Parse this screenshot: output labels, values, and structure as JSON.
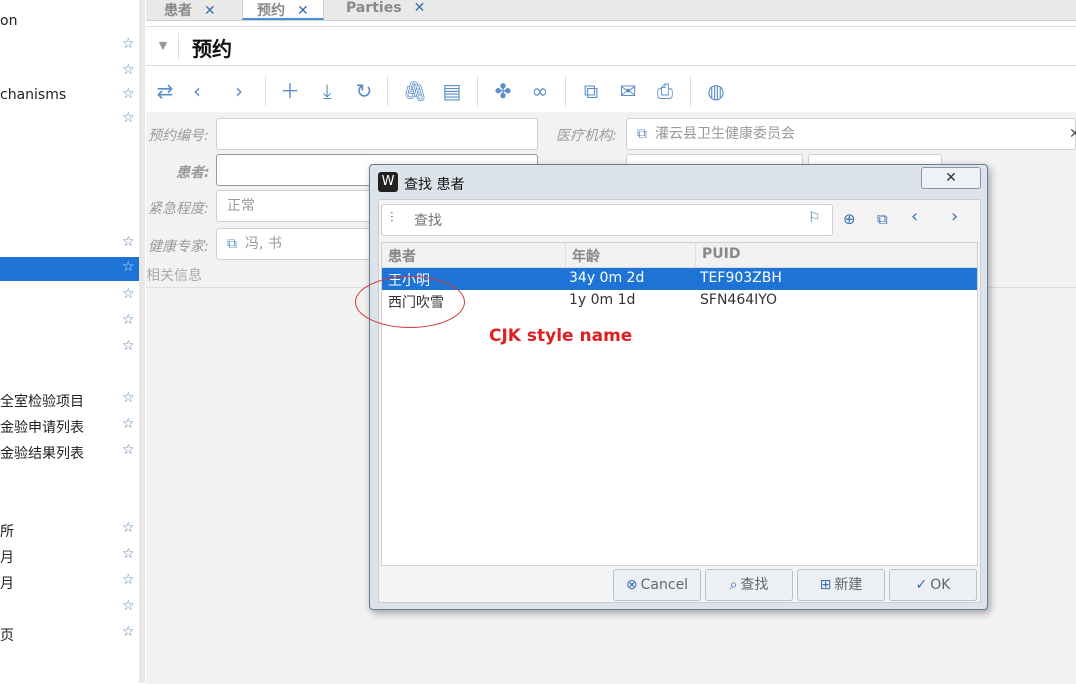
{
  "sidebar": {
    "items": [
      {
        "label": "on",
        "star": false
      },
      {
        "label": "",
        "star": true
      },
      {
        "label": "",
        "star": true
      },
      {
        "label": "chanisms",
        "star": true
      },
      {
        "label": "",
        "star": true
      },
      {
        "label": "",
        "star": true
      },
      {
        "label": "",
        "star": true
      },
      {
        "label": "",
        "star": true
      },
      {
        "label": "",
        "star": true
      },
      {
        "label": "",
        "star": true
      },
      {
        "label": "全室检验项目",
        "star": true
      },
      {
        "label": "金验申请列表",
        "star": true
      },
      {
        "label": "金验结果列表",
        "star": true
      },
      {
        "label": "所",
        "star": true
      },
      {
        "label": "月",
        "star": true
      },
      {
        "label": "月",
        "star": true
      },
      {
        "label": "",
        "star": true
      },
      {
        "label": "页",
        "star": true
      }
    ],
    "star_glyph": "☆"
  },
  "tabs": [
    {
      "label": "患者",
      "close": "✕"
    },
    {
      "label": "预约",
      "close": "✕"
    },
    {
      "label": "Parties",
      "close": "✕"
    }
  ],
  "page": {
    "collapse_glyph": "▼",
    "title": "预约"
  },
  "toolbar": {
    "icons": [
      "swap-icon",
      "chevron-left-icon",
      "chevron-right-icon",
      "add-icon",
      "download-icon",
      "refresh-icon",
      "paperclip-icon",
      "comment-icon",
      "fan-icon",
      "link-icon",
      "external-link-icon",
      "mail-icon",
      "print-icon",
      "globe-icon"
    ],
    "glyphs": [
      "⇄",
      "‹",
      "›",
      "＋",
      "⤓",
      "↻",
      "🖇",
      "▤",
      "✤",
      "∞",
      "⧉",
      "✉",
      "⎙",
      "◍"
    ]
  },
  "form": {
    "appointment_no_label": "预约编号:",
    "patient_label": "患者:",
    "urgency_label": "紧急程度:",
    "urgency_value": "正常",
    "specialist_label": "健康专家:",
    "specialist_value": "冯, 书",
    "facility_label": "医疗机构:",
    "facility_value": "灌云县卫生健康委员会",
    "related_info_label": "相关信息",
    "link_glyph": "⧉",
    "clear_glyph": "✕"
  },
  "dialog": {
    "logo_glyph": "W",
    "title": "查找 患者",
    "close_glyph": "✕",
    "search": {
      "filter_glyph": "⫶",
      "placeholder": "查找",
      "value": "",
      "bookmark_glyph": "⚐"
    },
    "nav_glyphs": [
      "⊕",
      "⧉",
      "‹",
      "›"
    ],
    "columns": [
      "患者",
      "年龄",
      "PUID"
    ],
    "rows": [
      {
        "name": "王小明",
        "age": "34y 0m 2d",
        "puid": "TEF903ZBH",
        "selected": true
      },
      {
        "name": "西门吹雪",
        "age": "1y 0m 1d",
        "puid": "SFN464IYO",
        "selected": false
      }
    ],
    "buttons": {
      "cancel": "Cancel",
      "search": "查找",
      "new": "新建",
      "ok": "OK",
      "cancel_icon": "⊗",
      "search_icon": "⌕",
      "new_icon": "⊞",
      "ok_icon": "✓"
    }
  },
  "annotation": {
    "text": "CJK style name",
    "color": "#e02020"
  },
  "colors": {
    "accent": "#1e73d6",
    "icon": "#3a6fb0"
  }
}
